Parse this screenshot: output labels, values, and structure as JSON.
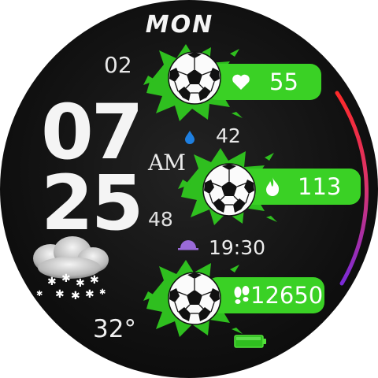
{
  "watch": {
    "day": "MON",
    "date": "02",
    "hour": "07",
    "minute": "25",
    "ampm": "AM",
    "seconds": "48",
    "humidity": "42",
    "sunset": "19:30",
    "temperature": "32°",
    "heart_rate": "55",
    "calories": "113",
    "steps": "12650",
    "weather": "snow-cloud-icon"
  },
  "colors": {
    "accent_green": "#3ad125",
    "splash_green": "#2fbf1f",
    "arc_top": "#ff2a2a",
    "arc_bottom": "#7a2ad8"
  }
}
